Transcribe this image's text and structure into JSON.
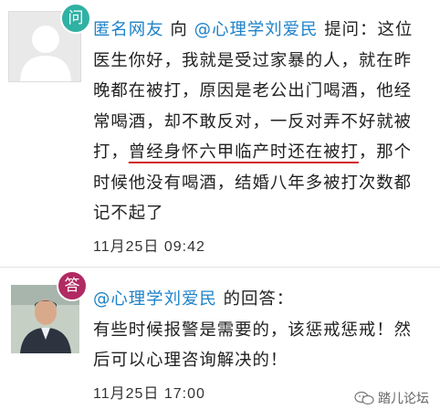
{
  "question": {
    "badge": "问",
    "user": "匿名网友",
    "direction_word": " 向 ",
    "target_user": "@心理学刘爱民",
    "ask_word": " 提问：",
    "body_before": "这位医生你好，我就是受过家暴的人，就在昨晚都在被打，原因是老公出门喝酒，他经常喝酒，却不敢反对，一反对弄不好就被打，",
    "body_highlight": "曾经身怀六甲临产时还在被打",
    "body_after": "，那个时候他没有喝酒，结婚八年多被打次数都记不起了",
    "time": "11月25日 09:42"
  },
  "answer": {
    "badge": "答",
    "user": "@心理学刘爱民",
    "reply_word": " 的回答：",
    "body": "有些时候报警是需要的，该惩戒惩戒！然后可以心理咨询解决的！",
    "time": "11月25日 17:00"
  },
  "watermark": {
    "text": "踏儿论坛",
    "icon": "wechat-icon"
  },
  "colors": {
    "link": "#1f83c9",
    "question_badge": "#2fb1a3",
    "answer_badge": "#b12a62",
    "underline": "#d21e1e"
  }
}
